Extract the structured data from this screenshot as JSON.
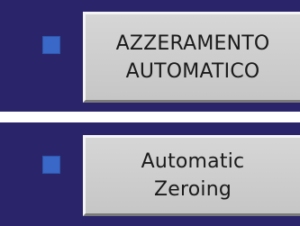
{
  "panels": [
    {
      "indicator": {
        "color": "#3a68c8"
      },
      "button": {
        "line1": "AZZERAMENTO",
        "line2": "AUTOMATICO"
      }
    },
    {
      "indicator": {
        "color": "#3a68c8"
      },
      "button": {
        "line1": "Automatic",
        "line2": "Zeroing"
      }
    }
  ],
  "colors": {
    "panel_background": "#2a246a",
    "button_face": "#cfcfcf",
    "separator": "#ffffff"
  }
}
